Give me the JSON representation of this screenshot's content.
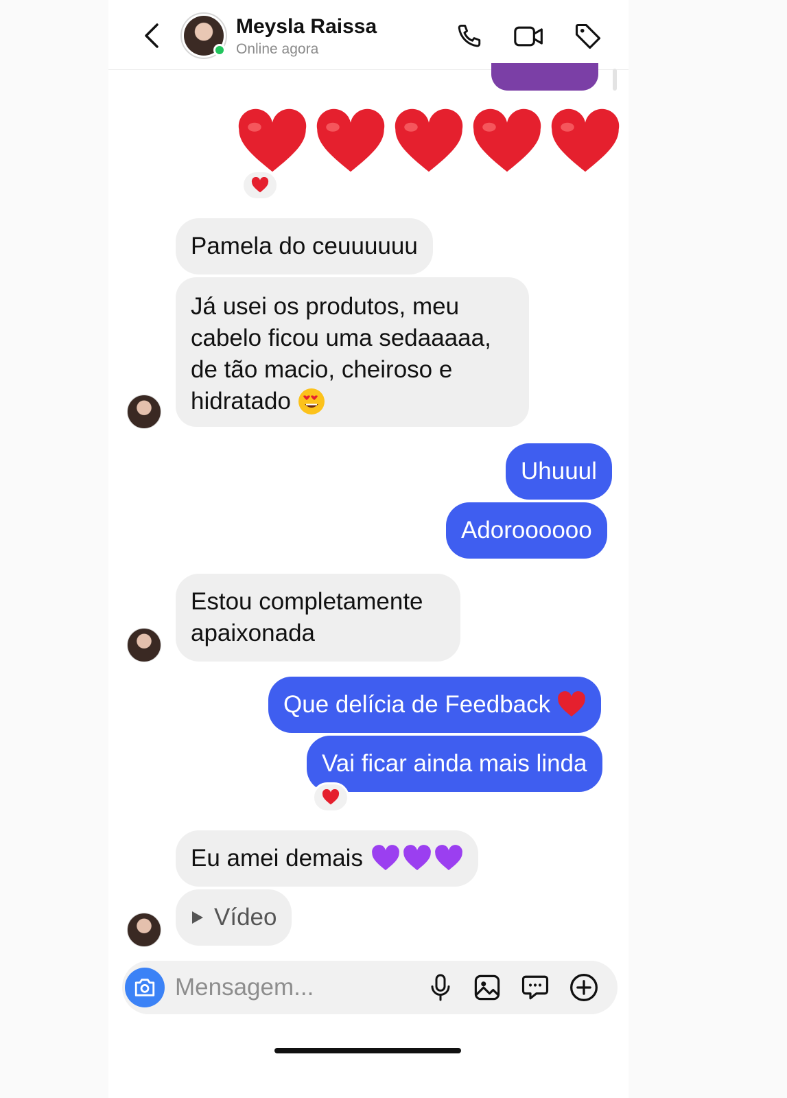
{
  "header": {
    "contact_name": "Meysla Raissa",
    "status": "Online agora",
    "icons": [
      "back-chevron-icon",
      "phone-icon",
      "video-camera-icon",
      "tag-icon"
    ]
  },
  "reactions": {
    "hearts_reaction": "heart",
    "out_reaction": "heart"
  },
  "messages": [
    {
      "from": "them",
      "text": "Pamela do ceuuuuuu"
    },
    {
      "from": "them",
      "text_lines": [
        "Já usei os produtos, meu",
        "cabelo ficou uma sedaaaaa,",
        "de tão macio, cheiroso e",
        "hidratado"
      ],
      "emoji": "heart-eyes"
    },
    {
      "from": "me",
      "text": "Uhuuul"
    },
    {
      "from": "me",
      "text": "Adoroooooo"
    },
    {
      "from": "them",
      "text_lines": [
        "Estou completamente",
        "apaixonada"
      ]
    },
    {
      "from": "me",
      "text": "Que delícia de Feedback",
      "emoji": "red-heart"
    },
    {
      "from": "me",
      "text": "Vai ficar ainda mais linda"
    },
    {
      "from": "them",
      "text": "Eu amei demais",
      "emoji": "purple-hearts"
    },
    {
      "from": "them",
      "text": "Vídeo"
    }
  ],
  "composer": {
    "placeholder": "Mensagem...",
    "icons": [
      "camera-icon",
      "microphone-icon",
      "gallery-icon",
      "sticker-icon",
      "plus-circle-icon"
    ]
  },
  "colors": {
    "outgoing": "#3f5ef0",
    "incoming": "#efefef",
    "online": "#22c55e",
    "camera_button": "#3b82f6",
    "heart": "#e5202e",
    "purple_heart": "#9b3ff0"
  }
}
